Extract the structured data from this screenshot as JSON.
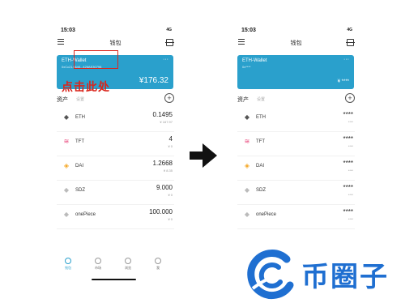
{
  "status": {
    "time": "15:03",
    "signal": "4G"
  },
  "nav": {
    "title": "钱包"
  },
  "wallet": {
    "name": "ETH-Wallet",
    "address_full": "0xCc214Ab8...426AE30798",
    "address_masked": "0x****",
    "balance": "¥176.32",
    "balance_masked": "¥ ****",
    "more": "···"
  },
  "annotation": {
    "tap_here": "点击此处"
  },
  "assets_header": {
    "label": "资产",
    "sub": "设置"
  },
  "assets_left": [
    {
      "symbol": "ETH",
      "amount": "0.1495",
      "value": "¥ 167.97",
      "icon": "eth-icon",
      "color": "#555555"
    },
    {
      "symbol": "TFT",
      "amount": "4",
      "value": "¥ 0",
      "icon": "tft-icon",
      "color": "#e8447a"
    },
    {
      "symbol": "DAI",
      "amount": "1.2668",
      "value": "¥ 8.35",
      "icon": "dai-icon",
      "color": "#f5a623"
    },
    {
      "symbol": "SDZ",
      "amount": "9.000",
      "value": "¥ 0",
      "icon": "sdz-icon",
      "color": "#bbbbbb"
    },
    {
      "symbol": "onePiece",
      "amount": "100.000",
      "value": "¥ 0",
      "icon": "onepiece-icon",
      "color": "#bbbbbb"
    }
  ],
  "assets_right": [
    {
      "symbol": "ETH",
      "amount": "****",
      "value": "****",
      "icon": "eth-icon",
      "color": "#555555"
    },
    {
      "symbol": "TFT",
      "amount": "****",
      "value": "****",
      "icon": "tft-icon",
      "color": "#e8447a"
    },
    {
      "symbol": "DAI",
      "amount": "****",
      "value": "****",
      "icon": "dai-icon",
      "color": "#f5a623"
    },
    {
      "symbol": "SDZ",
      "amount": "****",
      "value": "****",
      "icon": "sdz-icon",
      "color": "#bbbbbb"
    },
    {
      "symbol": "onePiece",
      "amount": "****",
      "value": "****",
      "icon": "onepiece-icon",
      "color": "#bbbbbb"
    }
  ],
  "tabs": [
    {
      "label": "钱包",
      "active": true
    },
    {
      "label": "市场",
      "active": false
    },
    {
      "label": "浏览",
      "active": false
    },
    {
      "label": "我",
      "active": false
    }
  ],
  "logo": {
    "text": "币圈子",
    "accent": "#1f6fd1"
  },
  "colors": {
    "card": "#2aa0cc",
    "annotation": "#d9251c"
  }
}
